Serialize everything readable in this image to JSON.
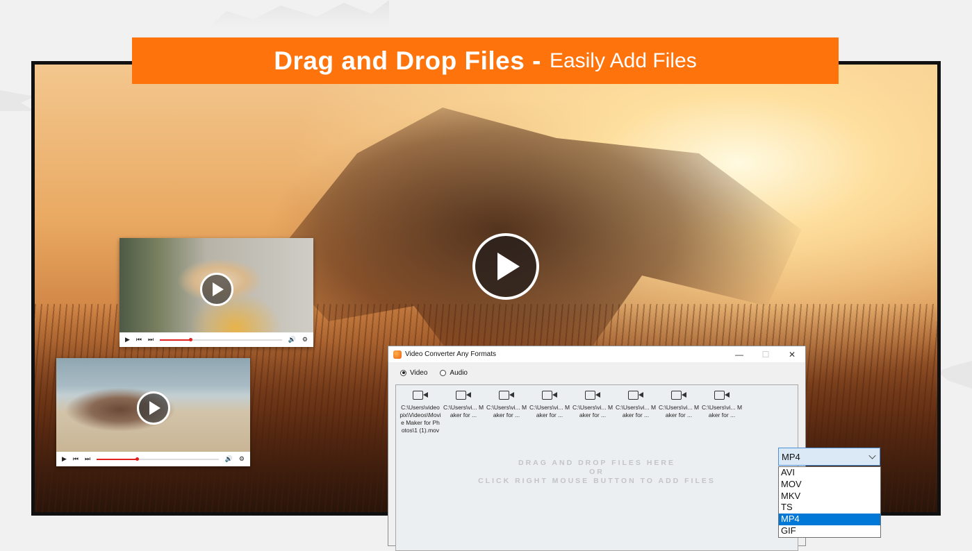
{
  "banner": {
    "bold_text": "Drag and Drop Files -",
    "light_text": "Easily Add Files"
  },
  "window": {
    "title": "Video Converter Any Formats",
    "controls": {
      "minimize": "—",
      "maximize": "☐",
      "close": "✕"
    },
    "radio": {
      "video": "Video",
      "audio": "Audio",
      "selected": "video"
    },
    "files": [
      {
        "name": "C:\\Users\\videopix\\Videos\\Movie Maker for Photos\\1 (1).mov"
      },
      {
        "name": "C:\\Users\\vi... Maker for ..."
      },
      {
        "name": "C:\\Users\\vi... Maker for ..."
      },
      {
        "name": "C:\\Users\\vi... Maker for ..."
      },
      {
        "name": "C:\\Users\\vi... Maker for ..."
      },
      {
        "name": "C:\\Users\\vi... Maker for ..."
      },
      {
        "name": "C:\\Users\\vi... Maker for ..."
      },
      {
        "name": "C:\\Users\\vi... Maker for ..."
      }
    ],
    "hint_line1": "DRAG AND DROP FILES HERE",
    "hint_line2": "OR",
    "hint_line3": "CLICK RIGHT MOUSE BUTTON TO ADD FILES"
  },
  "format_select": {
    "value": "MP4",
    "options": [
      "AVI",
      "MOV",
      "MKV",
      "TS",
      "MP4",
      "GIF"
    ],
    "highlighted": "MP4"
  },
  "mini_players": [
    {
      "progress": 0.25
    },
    {
      "progress": 0.33
    }
  ],
  "colors": {
    "banner": "#ff730d",
    "progress": "#e0201c",
    "selection": "#0078d7"
  }
}
